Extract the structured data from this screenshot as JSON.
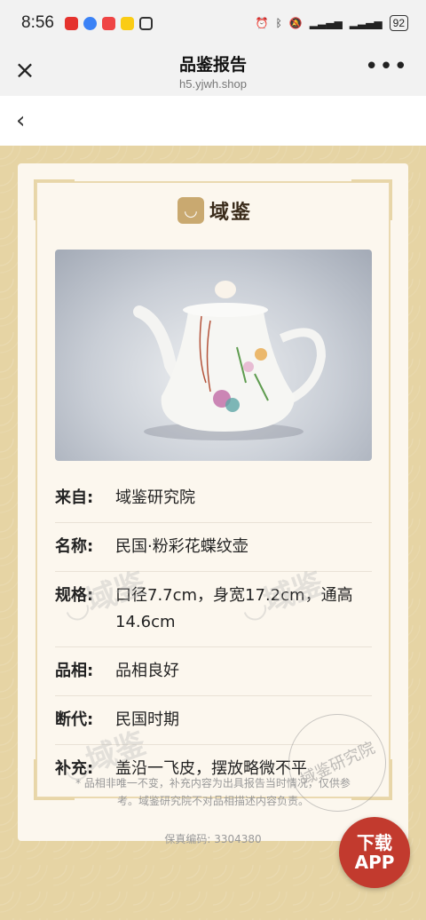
{
  "status": {
    "time": "8:56",
    "battery": "92"
  },
  "nav": {
    "title": "品鉴报告",
    "subtitle": "h5.yjwh.shop",
    "close": "×",
    "more": "•••"
  },
  "back": "‹",
  "logo": {
    "mark": "◡",
    "text": "域鉴"
  },
  "report": {
    "rows": [
      {
        "key": "来自:",
        "value": "域鉴研究院"
      },
      {
        "key": "名称:",
        "value": "民国·粉彩花蝶纹壶"
      },
      {
        "key": "规格:",
        "value": "口径7.7cm，身宽17.2cm，通高14.6cm"
      },
      {
        "key": "品相:",
        "value": "品相良好"
      },
      {
        "key": "断代:",
        "value": "民国时期"
      },
      {
        "key": "补充:",
        "value": "盖沿一飞皮，摆放略微不平"
      }
    ],
    "note": "* 品相非唯一不变，补充内容为出具报告当时情况，仅供参考。域鉴研究院不对品相描述内容负责。",
    "code_label": "保真编码:",
    "code": "3304380",
    "seal_text": "域鉴研究院"
  },
  "download": {
    "line1": "下载",
    "line2": "APP"
  },
  "colors": {
    "frame": "#e6d4a4",
    "card": "#fcf7ee",
    "download": "#c23a2e",
    "logo": "#c9a970"
  }
}
